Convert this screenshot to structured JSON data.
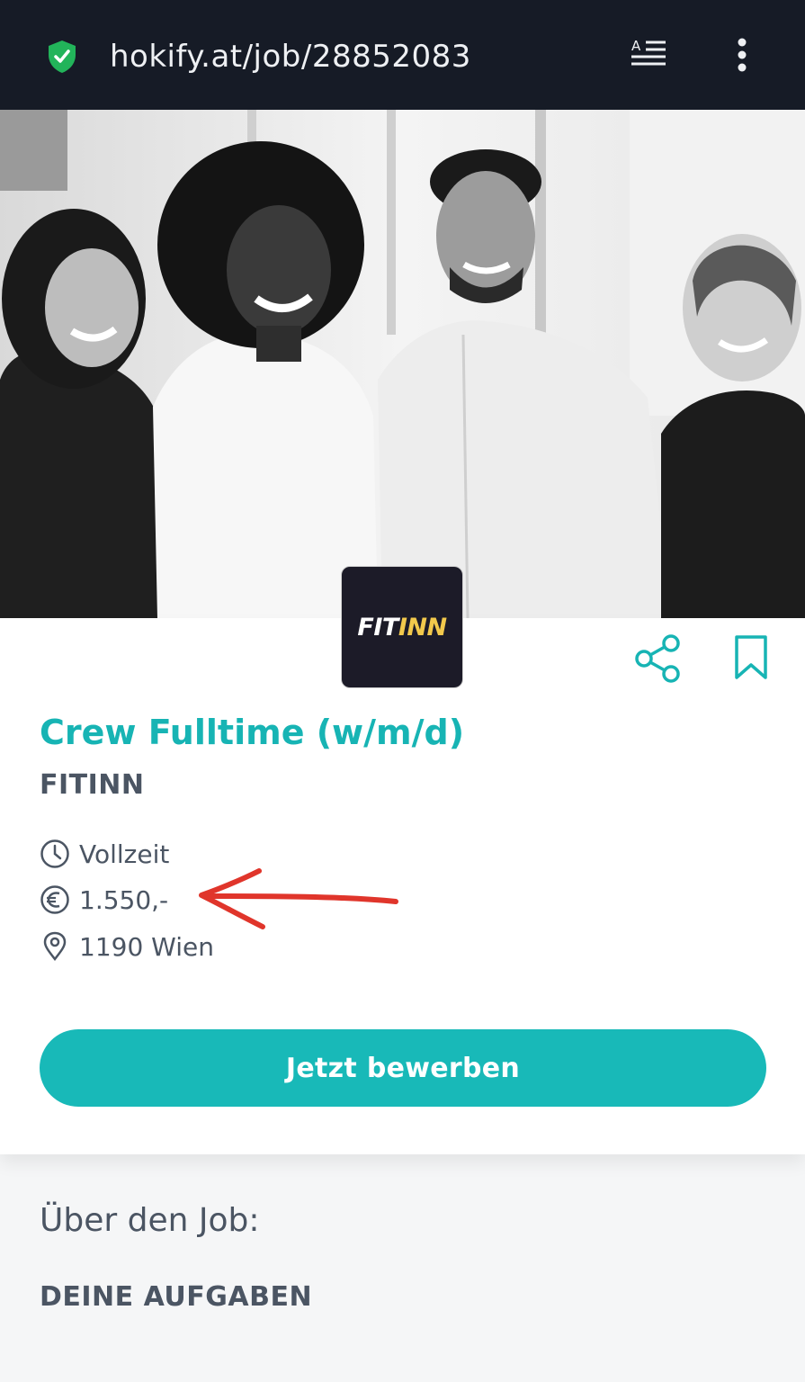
{
  "browser": {
    "url": "hokify.at/job/28852083",
    "security_icon": "shield-check-icon",
    "reader_icon": "reader-mode-icon",
    "menu_icon": "more-vertical-icon"
  },
  "job": {
    "company_logo": {
      "part1": "FIT",
      "part2": "INN"
    },
    "title": "Crew Fulltime (w/m/d)",
    "company": "FITINN",
    "details": [
      {
        "icon": "clock-icon",
        "text": "Vollzeit"
      },
      {
        "icon": "euro-icon",
        "text": "1.550,-"
      },
      {
        "icon": "location-pin-icon",
        "text": "1190 Wien"
      }
    ],
    "apply_label": "Jetzt bewerben",
    "share_icon": "share-icon",
    "save_icon": "bookmark-icon"
  },
  "content": {
    "about_heading": "Über den Job:",
    "tasks_heading": "DEINE AUFGABEN"
  },
  "colors": {
    "accent": "#17b4b4",
    "browser_bar": "#161b26",
    "text": "#4b5563",
    "annotation_arrow": "#e0352b"
  }
}
